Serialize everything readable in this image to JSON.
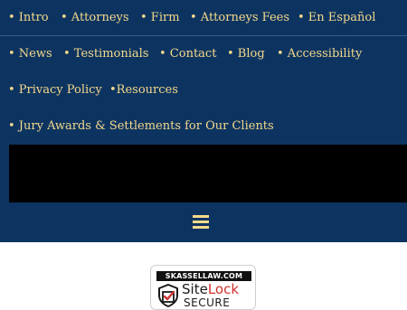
{
  "nav": {
    "row1": [
      "• Intro",
      "• Attorneys",
      "• Firm",
      "• Attorneys Fees",
      "• En Español"
    ],
    "row2": [
      "• News",
      "• Testimonials",
      "• Contact",
      "• Blog",
      "• Accessibility"
    ],
    "row3": [
      "• Privacy Policy",
      "•Resources"
    ],
    "row4": [
      "• Jury Awards & Settlements for Our Clients"
    ]
  },
  "menu_toggle": {
    "icon": "hamburger-menu-icon"
  },
  "sitelock": {
    "domain": "SKASSELLAW.COM",
    "brand_site": "Site",
    "brand_lock": "Lock",
    "status": "SECURE",
    "icon": "shield-check-icon"
  },
  "colors": {
    "nav_background": "#0d3461",
    "nav_link": "#f4d98a",
    "banner": "#000000",
    "sitelock_red": "#d0312d"
  }
}
